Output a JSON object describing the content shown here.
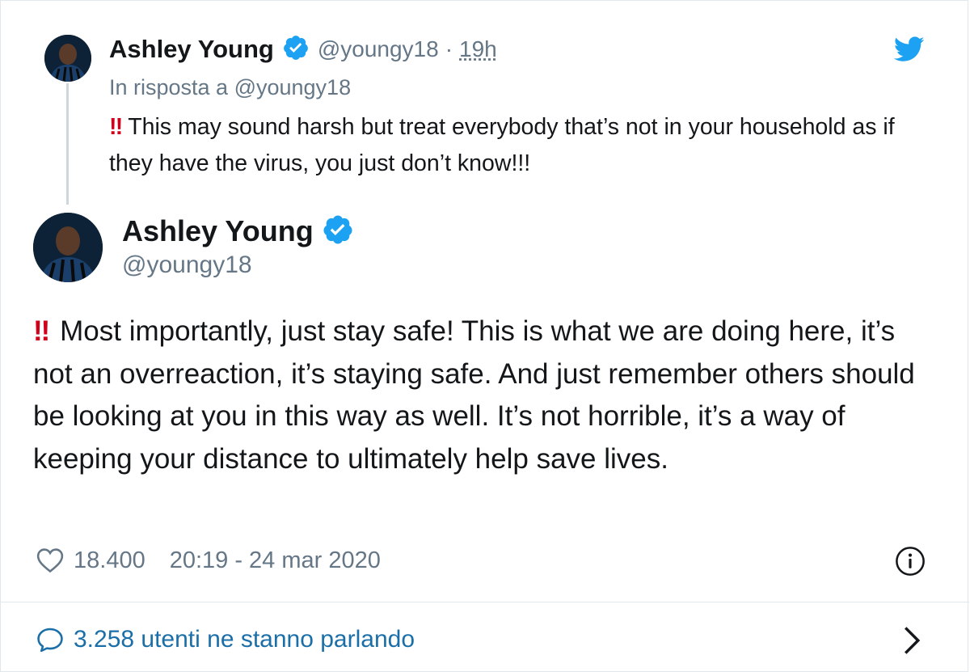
{
  "colors": {
    "verified_blue": "#1da1f2",
    "twitter_blue": "#1da1f2",
    "link_blue": "#1b6fa8",
    "gray_text": "#657786",
    "alert_red": "#d0021b"
  },
  "parent_tweet": {
    "author_name": "Ashley Young",
    "verified_icon": "verified-badge-icon",
    "handle": "@youngy18",
    "separator": "·",
    "relative_time": "19h",
    "reply_to": "In risposta a @youngy18",
    "emoji": "‼",
    "text": "This may sound harsh but treat everybody that’s not in your household as if they have the virus, you just don’t know!!!"
  },
  "main_tweet": {
    "author_name": "Ashley Young",
    "verified_icon": "verified-badge-icon",
    "handle": "@youngy18",
    "emoji": "‼",
    "text": "Most importantly, just stay safe! This is what we are doing here, it’s not an overreaction, it’s staying safe. And just remember others should be looking at you in this way as well. It’s not horrible, it’s a way of keeping your distance to ultimately help save lives."
  },
  "footer": {
    "like_icon": "heart-icon",
    "likes": "18.400",
    "timestamp": "20:19 - 24 mar 2020",
    "info_icon": "info-icon",
    "conversation_icon": "speech-bubble-icon",
    "conversation_text": "3.258 utenti ne stanno parlando",
    "chevron_icon": "chevron-right-icon"
  },
  "brand_icon": "twitter-bird-icon"
}
